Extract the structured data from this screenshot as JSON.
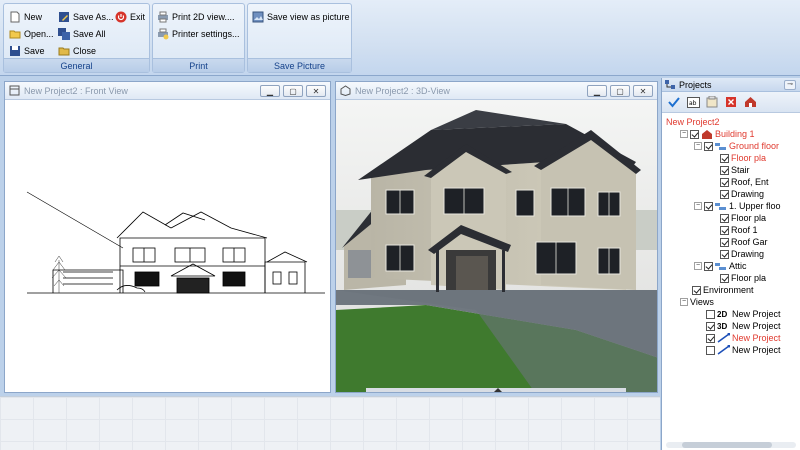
{
  "ribbon": {
    "general": {
      "caption": "General",
      "new": "New",
      "open": "Open...",
      "save": "Save",
      "save_as": "Save As...",
      "save_all": "Save All",
      "close": "Close",
      "exit": "Exit"
    },
    "print": {
      "caption": "Print",
      "print_2d": "Print 2D view....",
      "printer_settings": "Printer settings..."
    },
    "save_picture": {
      "caption": "Save Picture",
      "save_view": "Save view as picture"
    }
  },
  "windows": {
    "front": {
      "title": "New Project2 : Front View"
    },
    "view3d": {
      "title": "New Project2 : 3D-View"
    }
  },
  "panel": {
    "title": "Projects",
    "tree": {
      "project": "New Project2",
      "building": "Building 1",
      "ground_floor": "Ground floor",
      "ground_items": [
        "Floor pla",
        "Stair",
        "Roof, Ent",
        "Drawing"
      ],
      "upper_floor": "1. Upper floo",
      "upper_items": [
        "Floor pla",
        "Roof 1",
        "Roof Gar",
        "Drawing"
      ],
      "attic": "Attic",
      "attic_items": [
        "Floor pla"
      ],
      "environment": "Environment",
      "views": "Views",
      "view_items": [
        {
          "tag": "2D",
          "label": "New Project"
        },
        {
          "tag": "3D",
          "label": "New Project"
        },
        {
          "tag": "",
          "label": "New Project"
        },
        {
          "tag": "",
          "label": "New Project"
        }
      ]
    }
  },
  "colors": {
    "ribbon_bg": "#d2e0f1",
    "highlight_red": "#e03a2f",
    "panel_border": "#8ca6c9"
  }
}
